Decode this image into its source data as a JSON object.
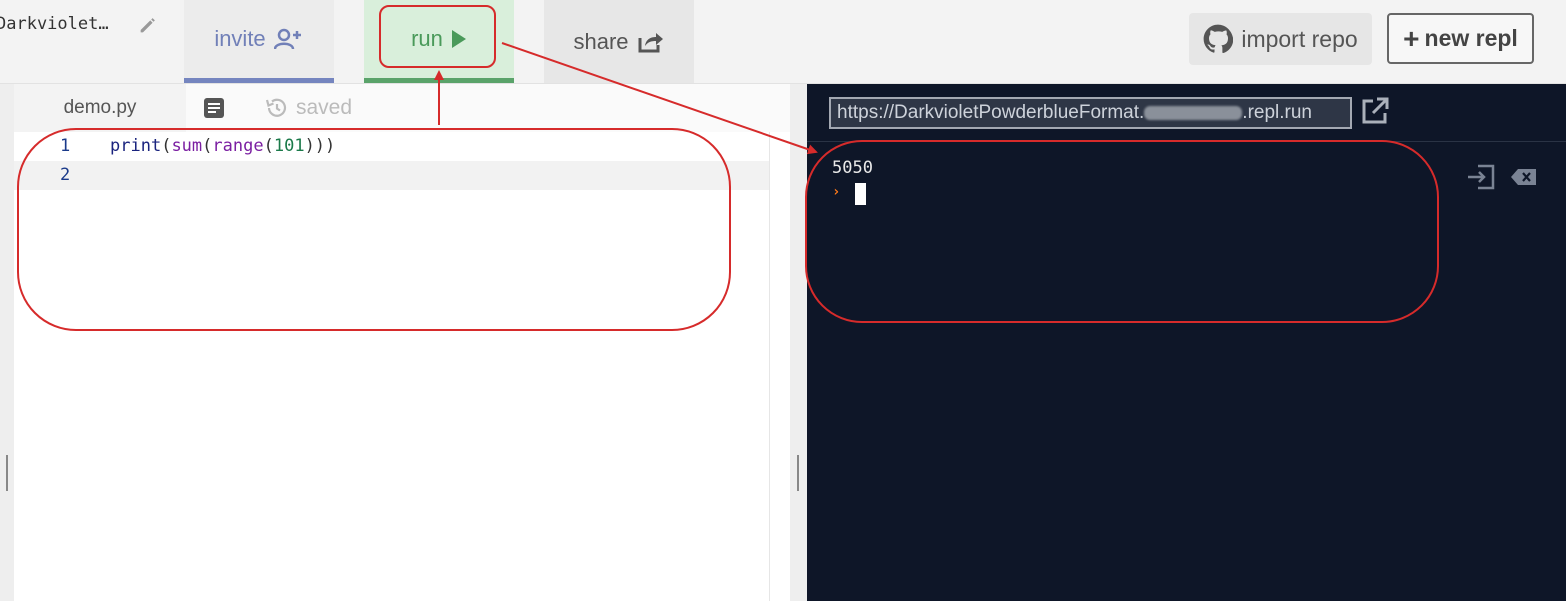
{
  "topbar": {
    "project_name": "Darkviolet…",
    "invite_label": "invite",
    "run_label": "run",
    "share_label": "share",
    "import_label": "import repo",
    "new_repl_label": "new repl",
    "new_repl_plus": "+"
  },
  "editor": {
    "file_name": "demo.py",
    "saved_label": "saved",
    "lines": [
      {
        "number": "1"
      },
      {
        "number": "2"
      }
    ]
  },
  "code": {
    "print": "print",
    "sum": "sum",
    "range": "range",
    "number": "101",
    "open": "(",
    "close_one": ")",
    "close_three": ")))"
  },
  "console": {
    "url_prefix": "https://DarkvioletPowderblueFormat.",
    "url_suffix": ".repl.run",
    "output": "5050",
    "prompt": "›"
  },
  "colors": {
    "annotation": "#d62b2b",
    "console_bg": "#0e1628",
    "run_green": "#4a9a5a",
    "invite_blue": "#7180b8"
  },
  "icons": [
    "pencil-icon",
    "add-user-icon",
    "play-icon",
    "share-icon",
    "github-icon",
    "files-icon",
    "history-icon",
    "open-external-icon",
    "input-icon",
    "clear-icon"
  ]
}
